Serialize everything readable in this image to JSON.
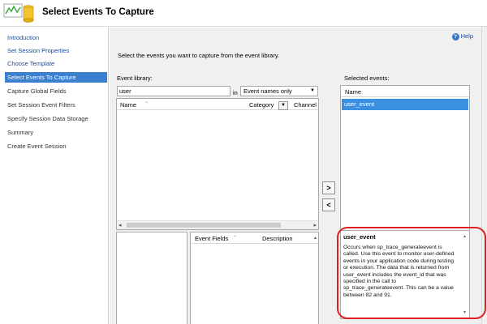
{
  "header": {
    "title": "Select Events To Capture",
    "icon": "session-wizard-icon"
  },
  "sidebar": {
    "items": [
      {
        "label": "Introduction",
        "state": "link"
      },
      {
        "label": "Set Session Properties",
        "state": "link"
      },
      {
        "label": "Choose Template",
        "state": "link"
      },
      {
        "label": "Select Events To Capture",
        "state": "selected"
      },
      {
        "label": "Capture Global Fields",
        "state": "disabled"
      },
      {
        "label": "Set Session Event Filters",
        "state": "disabled"
      },
      {
        "label": "Specify Session Data Storage",
        "state": "disabled"
      },
      {
        "label": "Summary",
        "state": "disabled"
      },
      {
        "label": "Create Event Session",
        "state": "disabled"
      }
    ]
  },
  "main": {
    "help_label": "Help",
    "instruction": "Select the events you want to capture from the event library.",
    "event_library_label": "Event library:",
    "search_value": "user",
    "in_label": "in",
    "filter_selected": "Event names only",
    "library_columns": {
      "name": "Name",
      "category": "Category",
      "channel": "Channel"
    },
    "fields_columns": {
      "fields": "Event Fields",
      "description": "Description"
    },
    "selected_events_label": "Selected events:",
    "selected_columns": {
      "name": "Name"
    },
    "selected_events": [
      "user_event"
    ],
    "move_right": ">",
    "move_left": "<",
    "description": {
      "title": "user_event",
      "text": "Occurs when sp_trace_generateevent is called. Use this event to monitor user-defined events in your application code during testing or execution. The data that is returned from user_event includes the event_id that was specified in the call to sp_trace_generateevent. This can be a value between 82 and 91."
    }
  },
  "colors": {
    "selection": "#3b7fcf",
    "selected_row": "#3b8fe0",
    "link": "#1a4a9b",
    "highlight": "#e02020"
  }
}
